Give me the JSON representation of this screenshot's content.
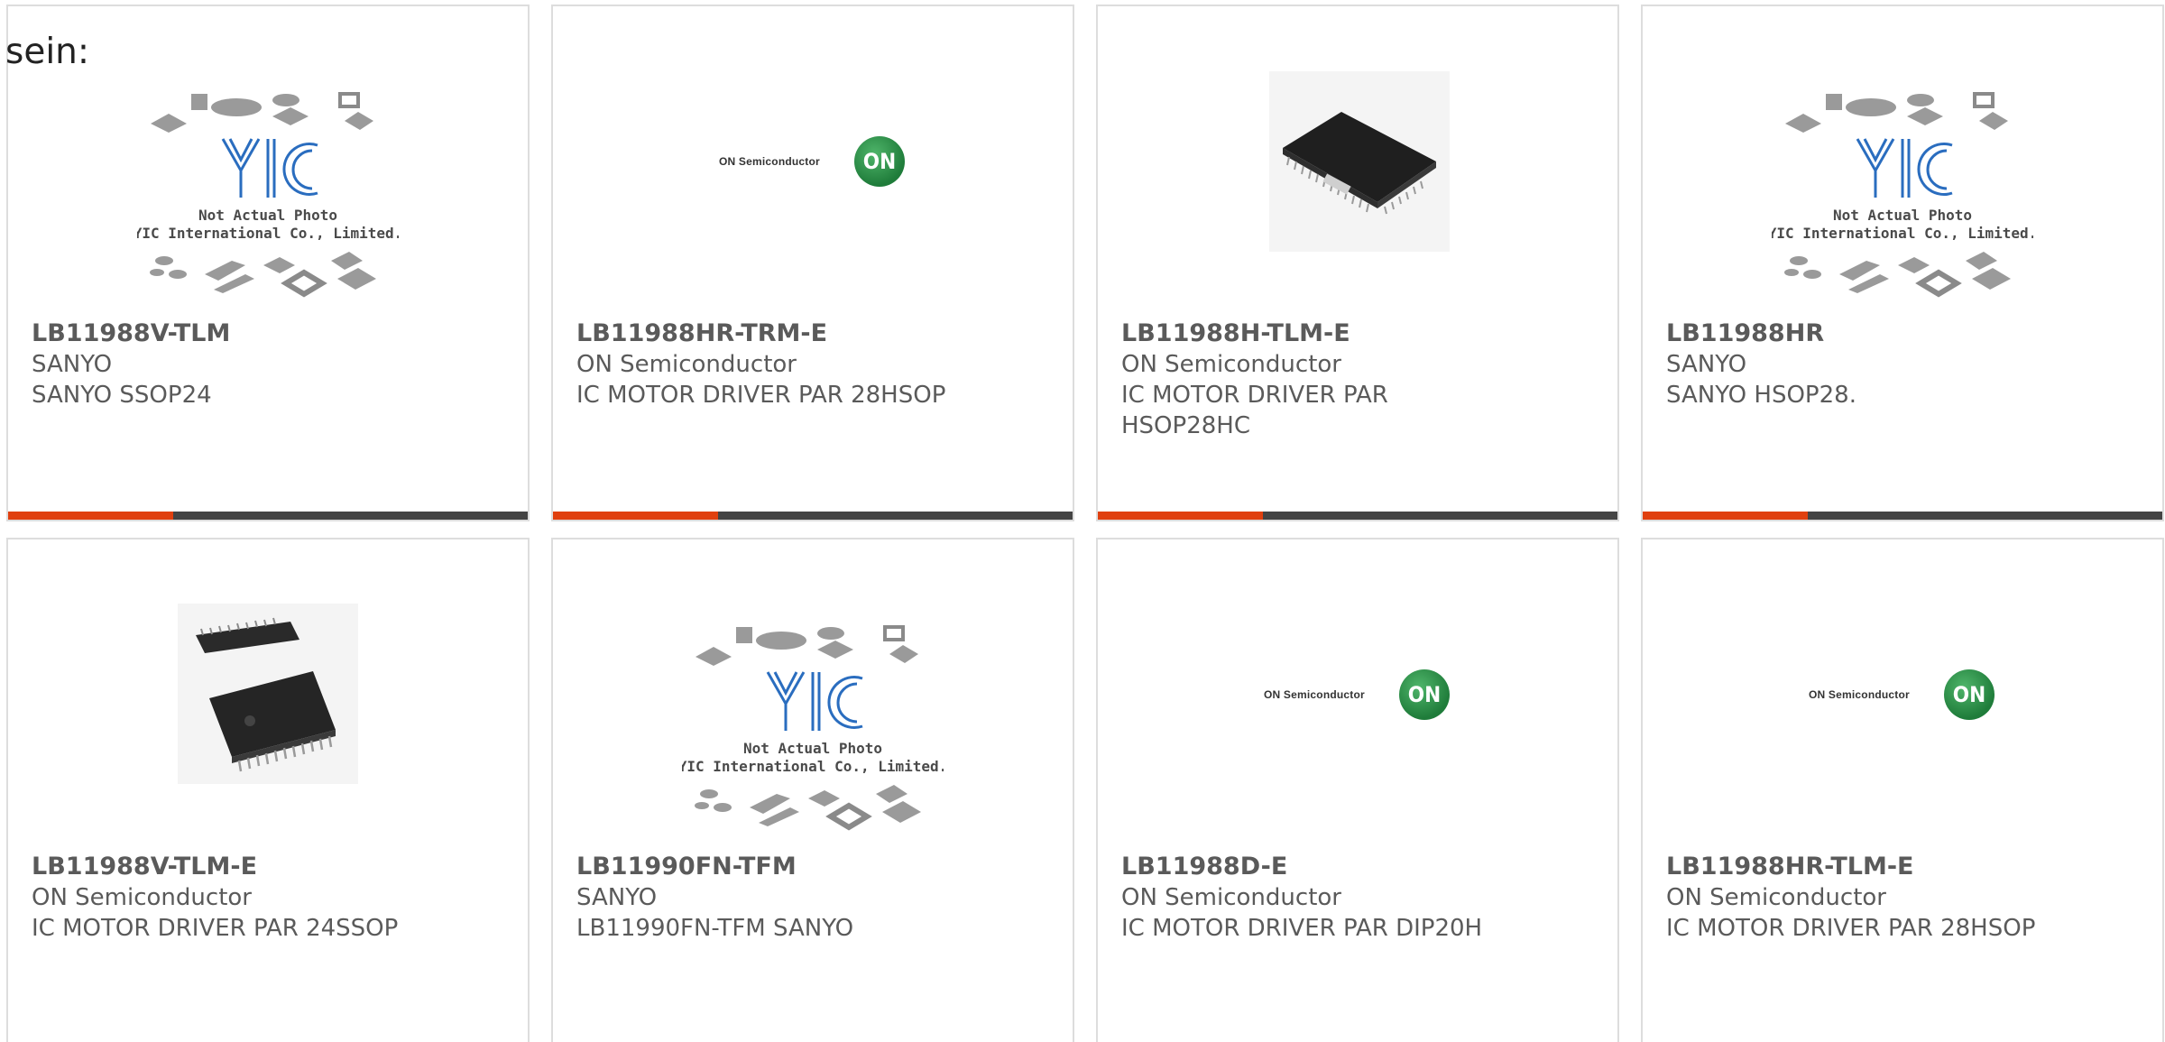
{
  "page": {
    "label": "sein:"
  },
  "colors": {
    "accent": "#e0400f",
    "bar": "#444444",
    "on_green": "#2e9a4e"
  },
  "placeholder": {
    "line1": "Not Actual Photo",
    "line2": "YIC International Co., Limited.",
    "brand": "YIC"
  },
  "onlogo": {
    "wordmark": "ON Semiconductor",
    "badge": "ON"
  },
  "products": [
    {
      "part": "LB11988V-TLM",
      "manufacturer": "SANYO",
      "description": "SANYO SSOP24",
      "image": "placeholder",
      "accent_bar": true
    },
    {
      "part": "LB11988HR-TRM-E",
      "manufacturer": "ON Semiconductor",
      "description": "IC MOTOR DRIVER PAR 28HSOP",
      "image": "on-logo",
      "accent_bar": true
    },
    {
      "part": "LB11988H-TLM-E",
      "manufacturer": "ON Semiconductor",
      "description": "IC MOTOR DRIVER PAR HSOP28HC",
      "image": "chip-hsop",
      "accent_bar": true
    },
    {
      "part": "LB11988HR",
      "manufacturer": "SANYO",
      "description": "SANYO HSOP28.",
      "image": "placeholder",
      "accent_bar": true
    },
    {
      "part": "LB11988V-TLM-E",
      "manufacturer": "ON Semiconductor",
      "description": "IC MOTOR DRIVER PAR 24SSOP",
      "image": "chip-ssop",
      "accent_bar": false
    },
    {
      "part": "LB11990FN-TFM",
      "manufacturer": "SANYO",
      "description": "LB11990FN-TFM SANYO",
      "image": "placeholder",
      "accent_bar": false
    },
    {
      "part": "LB11988D-E",
      "manufacturer": "ON Semiconductor",
      "description": "IC MOTOR DRIVER PAR DIP20H",
      "image": "on-logo",
      "accent_bar": false
    },
    {
      "part": "LB11988HR-TLM-E",
      "manufacturer": "ON Semiconductor",
      "description": "IC MOTOR DRIVER PAR 28HSOP",
      "image": "on-logo",
      "accent_bar": false
    }
  ]
}
